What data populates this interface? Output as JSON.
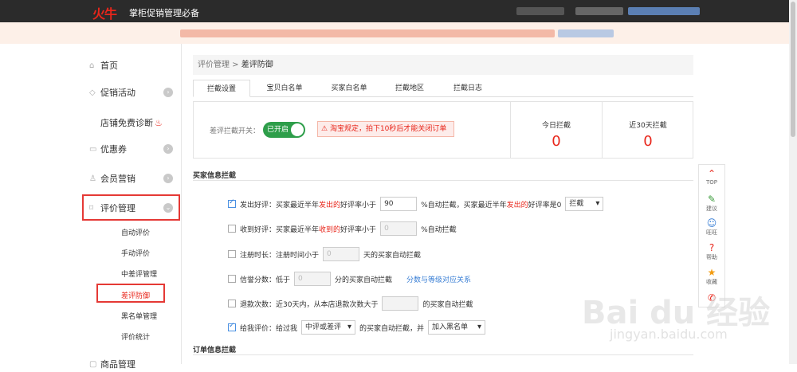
{
  "header": {
    "logo": "火牛",
    "tagline": "掌柜促销管理必备"
  },
  "sidebar": {
    "items": [
      {
        "label": "首页",
        "icon": "home-icon"
      },
      {
        "label": "促销活动",
        "icon": "tag-icon"
      },
      {
        "label": "店铺免费诊断",
        "icon": "flame-icon"
      },
      {
        "label": "优惠券",
        "icon": "coupon-icon"
      },
      {
        "label": "会员营销",
        "icon": "user-icon"
      },
      {
        "label": "评价管理",
        "icon": "comment-icon"
      },
      {
        "label": "商品管理",
        "icon": "goods-icon"
      }
    ],
    "sub_items": [
      "自动评价",
      "手动评价",
      "中差评管理",
      "差评防御",
      "黑名单管理",
      "评价统计"
    ]
  },
  "breadcrumb": {
    "parent": "评价管理",
    "separator": " > ",
    "current": "差评防御"
  },
  "tabs": [
    "拦截设置",
    "宝贝白名单",
    "买家白名单",
    "拦截地区",
    "拦截日志"
  ],
  "switch": {
    "label": "差评拦截开关：",
    "value": "已开启",
    "warning": "淘宝规定，拍下10秒后才能关闭订单"
  },
  "stats": [
    {
      "label": "今日拦截",
      "value": "0"
    },
    {
      "label": "近30天拦截",
      "value": "0"
    }
  ],
  "section_buyer": "买家信息拦截",
  "section_order": "订单信息拦截",
  "rules": {
    "r1": {
      "label": "发出好评：",
      "t1": "买家最近半年",
      "t2": "发出的",
      "t3": "好评率小于",
      "value": "90",
      "t4": "%自动拦截，买家最近半年",
      "t5": "发出的",
      "t6": "好评率是0",
      "select": "拦截"
    },
    "r2": {
      "label": "收到好评：",
      "t1": "买家最近半年",
      "t2": "收到的",
      "t3": "好评率小于",
      "value": "0",
      "t4": "%自动拦截"
    },
    "r3": {
      "label": "注册时长：",
      "t1": "注册时间小于",
      "value": "0",
      "t2": "天的买家自动拦截"
    },
    "r4": {
      "label": "信誉分数：",
      "t1": "低于",
      "value": "0",
      "t2": "分的买家自动拦截",
      "link": "分数与等级对应关系"
    },
    "r5": {
      "label": "退款次数：",
      "t1": "近30天内，从本店退款次数大于",
      "value": "",
      "t2": "的买家自动拦截"
    },
    "r6": {
      "label": "给我评价：",
      "t1": "给过我",
      "select1": "中评或差评",
      "t2": "的买家自动拦截，并",
      "select2": "加入黑名单"
    }
  },
  "floatbar": [
    "TOP",
    "建议",
    "旺旺",
    "帮助",
    "收藏"
  ],
  "watermark": {
    "brand": "Bai du 经验",
    "url": "jingyan.baidu.com"
  },
  "colors": {
    "accent_red": "#e8261b",
    "switch_green": "#2e9e4a",
    "link_blue": "#3a7fd5"
  }
}
